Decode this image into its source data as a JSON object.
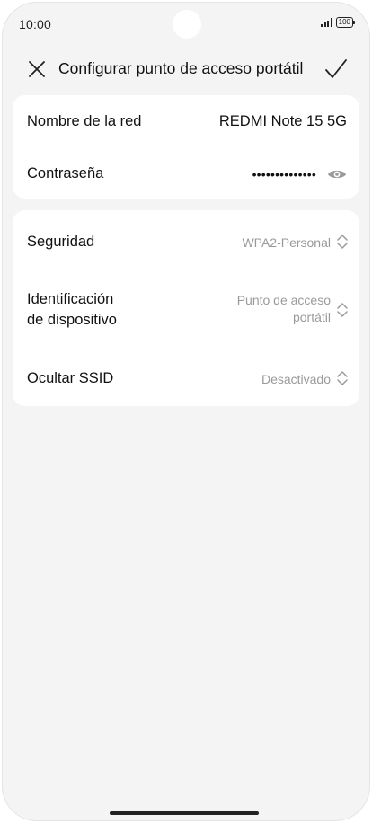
{
  "status_bar": {
    "time": "10:00",
    "battery": "100"
  },
  "header": {
    "title": "Configurar punto de acceso portátil"
  },
  "network": {
    "name_label": "Nombre de la red",
    "name_value": "REDMI Note 15 5G",
    "password_label": "Contraseña",
    "password_value": "••••••••••••••"
  },
  "settings": {
    "security_label": "Seguridad",
    "security_value": "WPA2-Personal",
    "device_id_label_line1": "Identificación",
    "device_id_label_line2": "de dispositivo",
    "device_id_value_line1": "Punto de acceso",
    "device_id_value_line2": "portátil",
    "hide_ssid_label": "Ocultar SSID",
    "hide_ssid_value": "Desactivado"
  },
  "icons": {
    "close": "close-icon",
    "confirm": "checkmark-icon",
    "visibility": "eye-icon",
    "selector": "chevron-up-down-icon"
  }
}
